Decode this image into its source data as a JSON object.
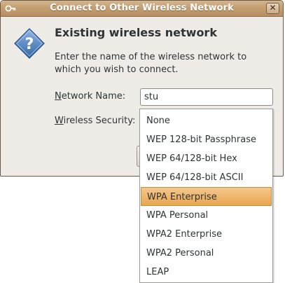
{
  "window": {
    "title": "Connect to Other Wireless Network",
    "close_glyph": "✕"
  },
  "icons": {
    "title_icon": "key-icon",
    "dialog_icon": "question-icon"
  },
  "dialog": {
    "heading": "Existing wireless network",
    "description": "Enter the name of the wireless network to which you wish to connect."
  },
  "form": {
    "network_name": {
      "label_mnemonic": "N",
      "label_rest": "etwork Name:",
      "value": "stu"
    },
    "wireless_security": {
      "label_mnemonic": "W",
      "label_rest": "ireless Security:",
      "selected": "WPA Enterprise"
    }
  },
  "dropdown": {
    "options": [
      "None",
      "WEP 128-bit Passphrase",
      "WEP 64/128-bit Hex",
      "WEP 64/128-bit ASCII",
      "WPA Enterprise",
      "WPA Personal",
      "WPA2 Enterprise",
      "WPA2 Personal",
      "LEAP"
    ]
  },
  "colors": {
    "titlebar": "#c49e72",
    "selection": "#e8a651",
    "dialog_bg": "#efebe7"
  }
}
